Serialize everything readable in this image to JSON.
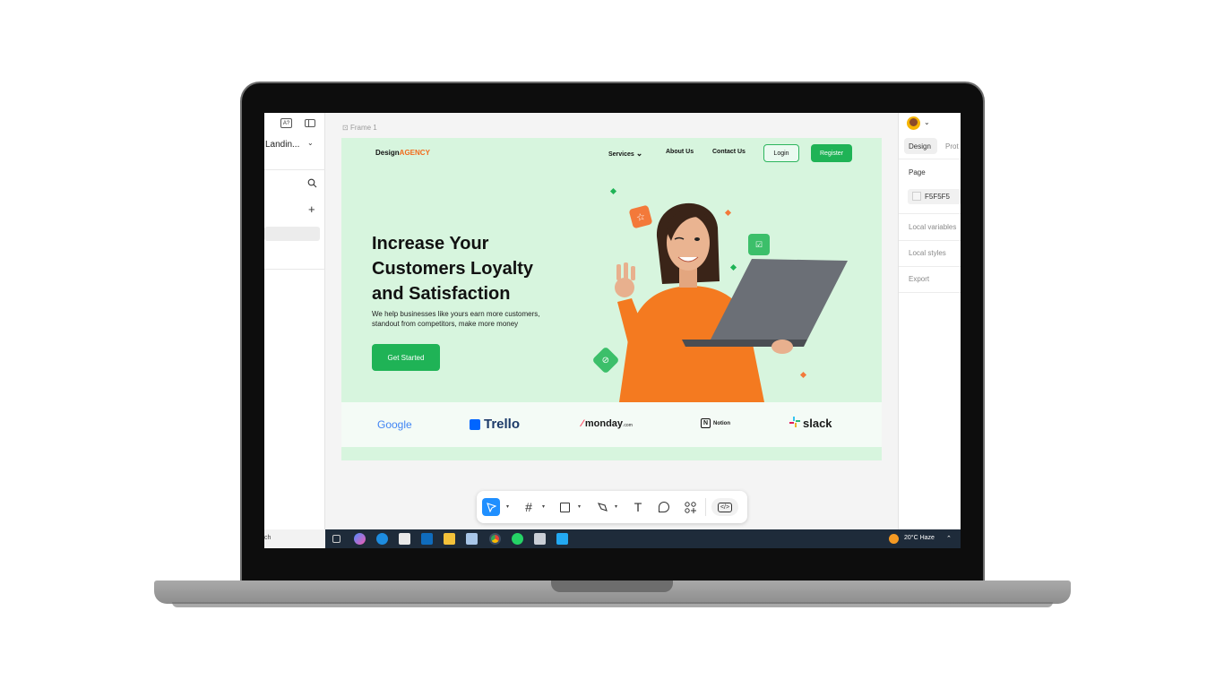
{
  "left_panel": {
    "file_name": "Landin...",
    "font_icon_label": "A?"
  },
  "canvas": {
    "frame_label": "Frame 1"
  },
  "site": {
    "brand_prefix": "Design",
    "brand_accent": "AGENCY",
    "nav": {
      "services": "Services",
      "about": "About Us",
      "contact": "Contact Us",
      "login": "Login",
      "register": "Register"
    },
    "hero": {
      "title_line1": "Increase Your",
      "title_line2": "Customers Loyalty",
      "title_line3": "and Satisfaction",
      "subtitle_line1": "We help businesses like yours earn more customers,",
      "subtitle_line2": "standout from competitors,  make more money",
      "cta": "Get Started"
    },
    "logos": {
      "google": "Google",
      "trello": "Trello",
      "monday": "monday",
      "monday_suffix": ".com",
      "notion": "Notion",
      "slack": "slack"
    },
    "colors": {
      "accent_green": "#1fb356",
      "accent_orange": "#f26a1b",
      "hero_bg": "#d7f5de"
    }
  },
  "right_panel": {
    "tab_design": "Design",
    "tab_prototype": "Prot",
    "page_label": "Page",
    "page_color": "F5F5F5",
    "local_variables": "Local variables",
    "local_styles": "Local styles",
    "export": "Export"
  },
  "taskbar": {
    "search_partial": "ch",
    "weather": "20°C  Haze"
  }
}
